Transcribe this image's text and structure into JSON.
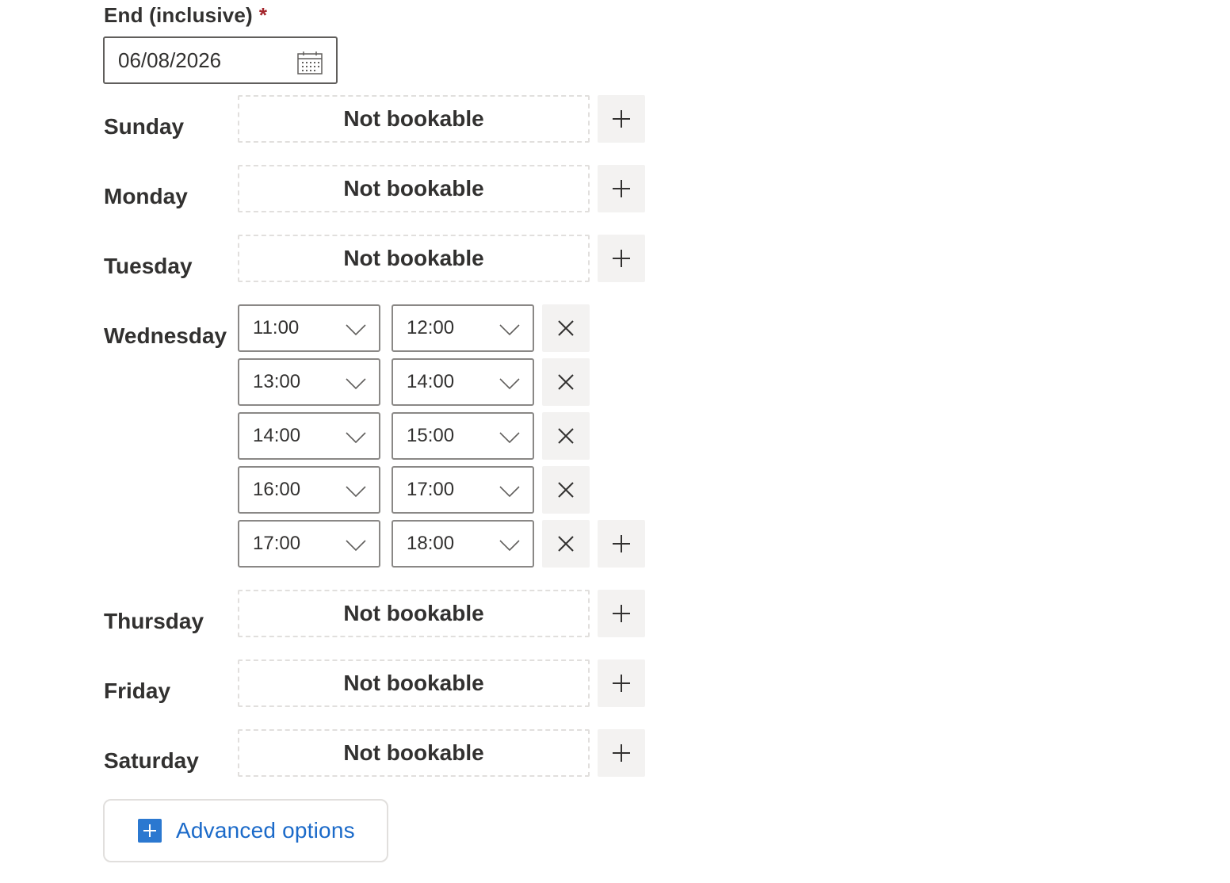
{
  "end_field": {
    "label": "End (inclusive)",
    "required_mark": "*",
    "value": "06/08/2026"
  },
  "not_bookable_text": "Not bookable",
  "days": {
    "sunday": "Sunday",
    "monday": "Monday",
    "tuesday": "Tuesday",
    "wednesday": "Wednesday",
    "thursday": "Thursday",
    "friday": "Friday",
    "saturday": "Saturday"
  },
  "wednesday_slots": [
    {
      "start": "11:00",
      "end": "12:00"
    },
    {
      "start": "13:00",
      "end": "14:00"
    },
    {
      "start": "14:00",
      "end": "15:00"
    },
    {
      "start": "16:00",
      "end": "17:00"
    },
    {
      "start": "17:00",
      "end": "18:00"
    }
  ],
  "advanced_options_label": "Advanced options"
}
